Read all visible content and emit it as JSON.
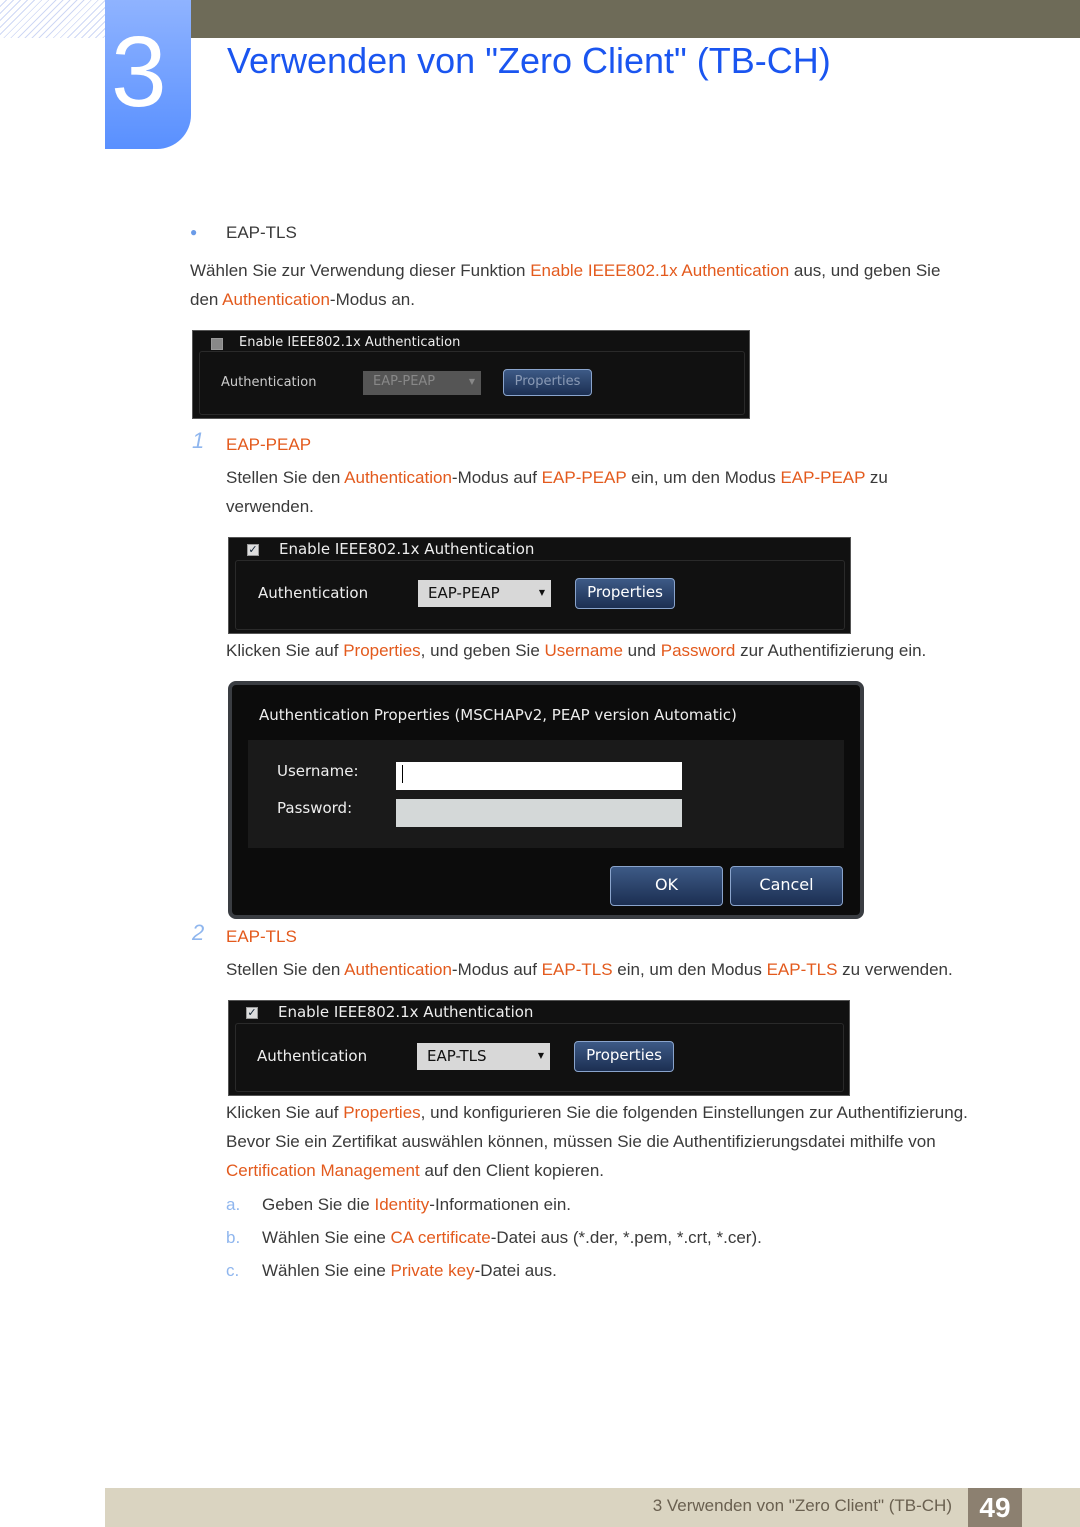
{
  "header": {
    "chapter_number": "3",
    "title": "Verwenden von \"Zero Client\" (TB-CH)"
  },
  "intro": {
    "bullet": "EAP-TLS",
    "p1": [
      "Wählen Sie zur Verwendung dieser Funktion ",
      "Enable IEEE802.1x Authentication",
      " aus, und geben Sie"
    ],
    "p2": [
      "den ",
      "Authentication",
      "-Modus an."
    ]
  },
  "screen1": {
    "checkbox_label": "Enable IEEE802.1x Authentication",
    "checked": false,
    "auth_label": "Authentication",
    "select_value": "EAP-PEAP",
    "properties": "Properties"
  },
  "section1": {
    "number": "1",
    "heading": "EAP-PEAP",
    "p1": [
      "Stellen Sie den ",
      "Authentication",
      "-Modus auf ",
      "EAP-PEAP",
      " ein, um den Modus ",
      "EAP-PEAP",
      " zu"
    ],
    "p2": "verwenden.",
    "p3": [
      "Klicken Sie auf ",
      "Properties",
      ", und geben Sie ",
      "Username",
      " und ",
      "Password",
      " zur Authentifizierung ein."
    ]
  },
  "screen2": {
    "checkbox_label": "Enable IEEE802.1x Authentication",
    "checked": true,
    "auth_label": "Authentication",
    "select_value": "EAP-PEAP",
    "properties": "Properties"
  },
  "dialog": {
    "title": "Authentication Properties (MSCHAPv2, PEAP version Automatic)",
    "username_label": "Username:",
    "username_value": "",
    "password_label": "Password:",
    "password_value": "",
    "ok": "OK",
    "cancel": "Cancel"
  },
  "section2": {
    "number": "2",
    "heading": "EAP-TLS",
    "p1": [
      "Stellen Sie den ",
      "Authentication",
      "-Modus auf ",
      "EAP-TLS",
      " ein, um den Modus ",
      "EAP-TLS",
      " zu verwenden."
    ],
    "p2": [
      "Klicken Sie auf ",
      "Properties",
      ", und konfigurieren Sie die folgenden Einstellungen zur Authentifizierung."
    ],
    "p3": "Bevor Sie ein Zertifikat auswählen können, müssen Sie die Authentifizierungsdatei mithilfe von",
    "p4": [
      "Certification Management",
      " auf den Client kopieren."
    ],
    "list": [
      {
        "letter": "a.",
        "parts": [
          "Geben Sie die ",
          "Identity",
          "-Informationen ein."
        ]
      },
      {
        "letter": "b.",
        "parts": [
          "Wählen Sie eine ",
          "CA certificate",
          "-Datei aus (*.der, *.pem, *.crt, *.cer)."
        ]
      },
      {
        "letter": "c.",
        "parts": [
          "Wählen Sie eine ",
          "Private key",
          "-Datei aus."
        ]
      }
    ]
  },
  "screen3": {
    "checkbox_label": "Enable IEEE802.1x Authentication",
    "checked": true,
    "auth_label": "Authentication",
    "select_value": "EAP-TLS",
    "properties": "Properties"
  },
  "footer": {
    "text": "3 Verwenden von \"Zero Client\" (TB-CH)",
    "page": "49"
  },
  "colors": {
    "accent": "#e35a1d",
    "title": "#1a55f0",
    "footer_band": "#dad4c1",
    "page_box": "#8c8070"
  }
}
